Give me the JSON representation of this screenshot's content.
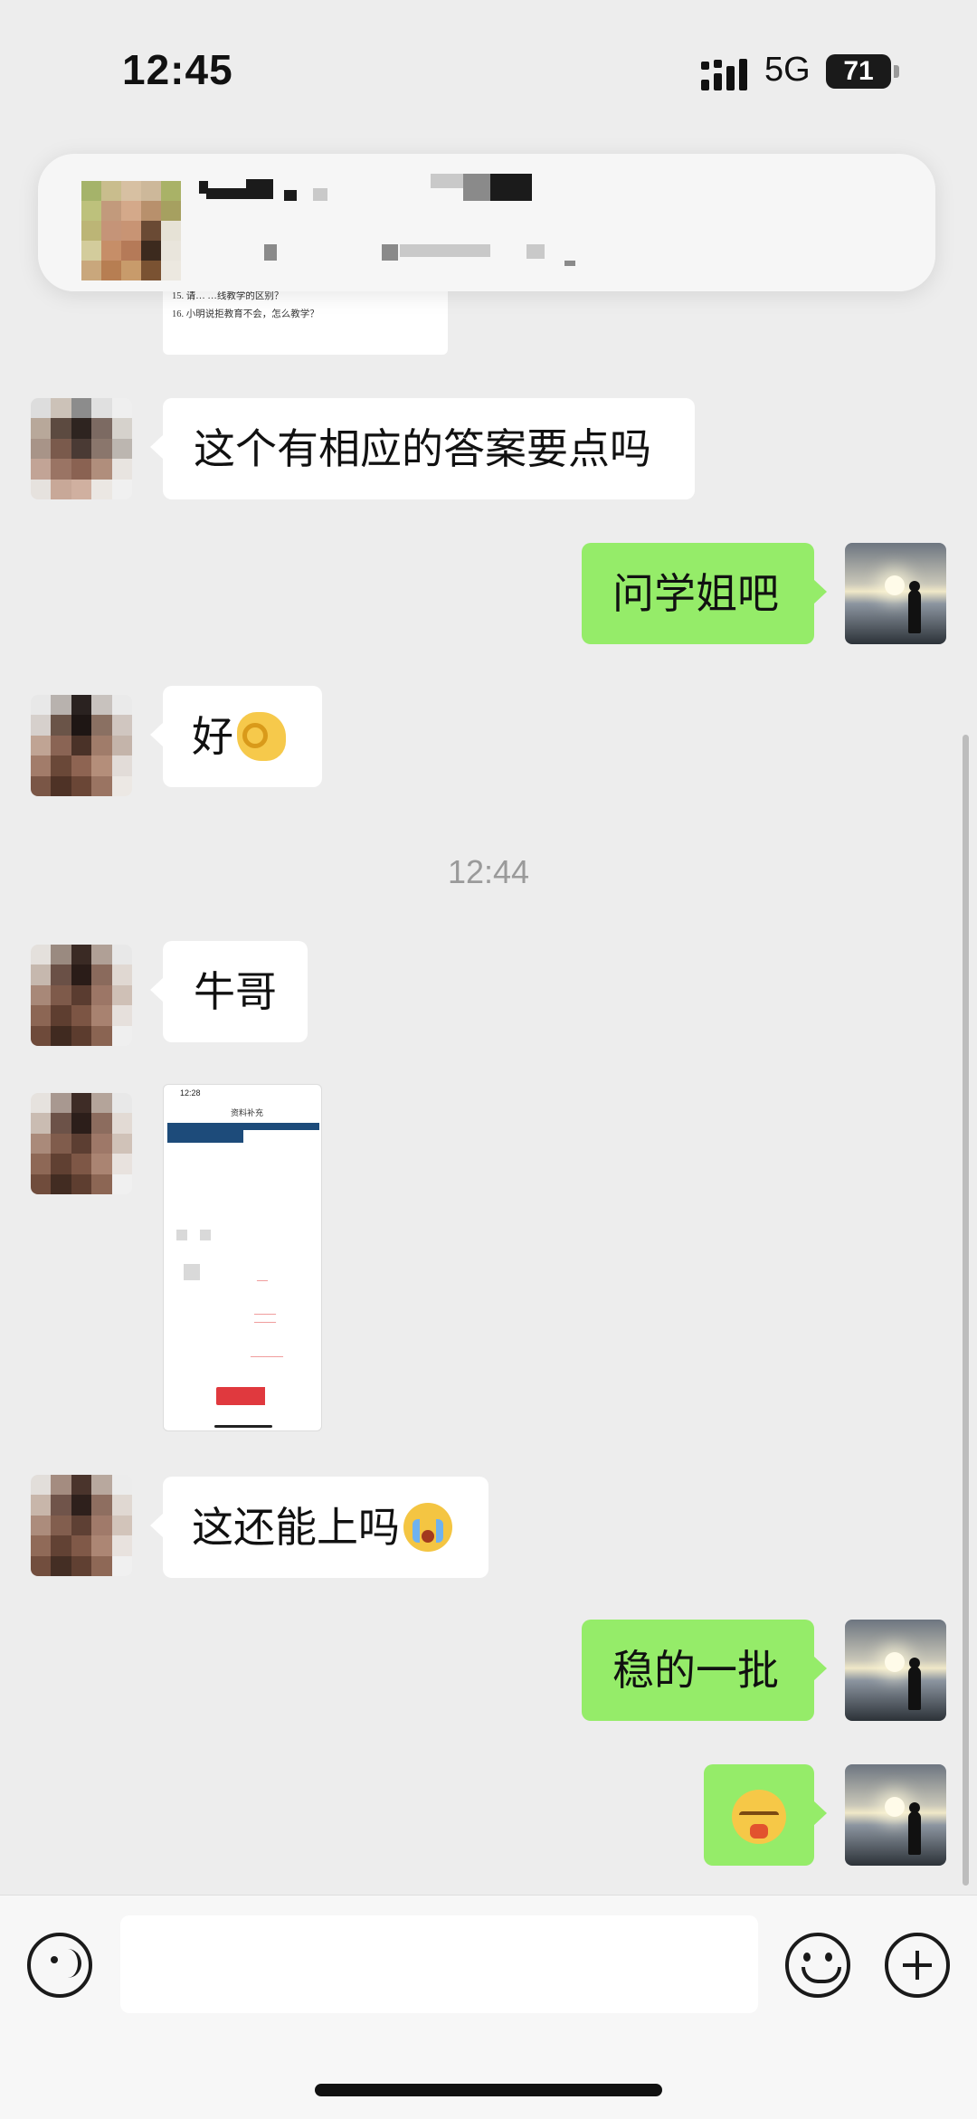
{
  "status_bar": {
    "time": "12:45",
    "network": "5G",
    "battery": "71"
  },
  "notification": {
    "sender": "",
    "preview": ""
  },
  "partial_document": {
    "line_15": "15. 请…           …线教学的区别？",
    "line_16": "16. 小明说拒教育不会，怎么教学？"
  },
  "messages": [
    {
      "side": "in",
      "text": "这个有相应的答案要点吗"
    },
    {
      "side": "out",
      "text": "问学姐吧"
    },
    {
      "side": "in",
      "text": "好",
      "emoji": "ok-hand"
    },
    {
      "side": "in",
      "text": "牛哥"
    },
    {
      "side": "in",
      "text": "这还能上吗",
      "emoji": "loudly-crying"
    },
    {
      "side": "out",
      "text": "稳的一批"
    },
    {
      "side": "out",
      "text": "",
      "emoji": "shushing-face"
    }
  ],
  "timestamp": "12:44",
  "screenshot_message": {
    "time": "12:28",
    "title": "资料补充"
  },
  "colors": {
    "chat_bg": "#ededed",
    "incoming_bubble": "#ffffff",
    "outgoing_bubble": "#95ec69"
  }
}
